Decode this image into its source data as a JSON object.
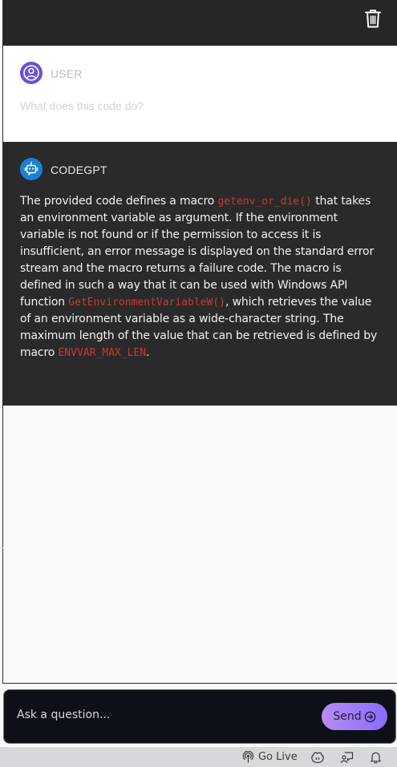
{
  "header": {
    "delete_icon": "trash-icon"
  },
  "user_message": {
    "role": "USER",
    "text": "What does this code do?",
    "avatar_icon": "user-circle-icon",
    "avatar_color": "#6a4fd8"
  },
  "bot_message": {
    "role": "CODEGPT",
    "avatar_icon": "robot-icon",
    "avatar_color": "#1e7fd9",
    "text_parts": [
      "The provided code defines a macro ",
      "getenv_or_die()",
      " that takes an environment variable as argument. If the environment variable is not found or if the permission to access it is insufficient, an error message is displayed on the standard error stream and the macro returns a failure code. The macro is defined in such a way that it can be used with Windows API function ",
      "GetEnvironmentVariableW()",
      ", which retrieves the value of an environment variable as a wide-character string. The maximum length of the value that can be retrieved is defined by macro ",
      "ENVVAR_MAX_LEN",
      "."
    ]
  },
  "input": {
    "placeholder": "Ask a question...",
    "value": "",
    "send_label": "Send",
    "send_icon": "arrow-circle-right-icon"
  },
  "status_bar": {
    "go_live_label": "Go Live",
    "go_live_icon": "broadcast-icon",
    "copilot_icon": "copilot-icon",
    "feedback_icon": "feedback-icon",
    "notifications_icon": "bell-icon"
  },
  "colors": {
    "accent_purple": "#8a6cff",
    "code_red": "#c53a3a",
    "dark_panel": "#2a2a2a"
  }
}
